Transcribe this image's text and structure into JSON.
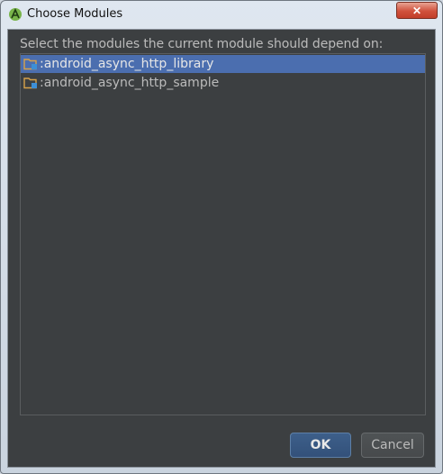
{
  "window": {
    "title": "Choose Modules",
    "close_label": "✕"
  },
  "instruction": "Select the modules the current module should depend on:",
  "modules": [
    {
      "label": ":android_async_http_library",
      "selected": true
    },
    {
      "label": ":android_async_http_sample",
      "selected": false
    }
  ],
  "buttons": {
    "ok_label": "OK",
    "cancel_label": "Cancel"
  },
  "colors": {
    "background": "#3c3f41",
    "selection": "#4b6eaf",
    "text": "#bbbbbb",
    "ok_button": "#365880"
  },
  "icons": {
    "app": "android-studio-icon",
    "module": "module-folder-icon",
    "close": "close-icon"
  }
}
